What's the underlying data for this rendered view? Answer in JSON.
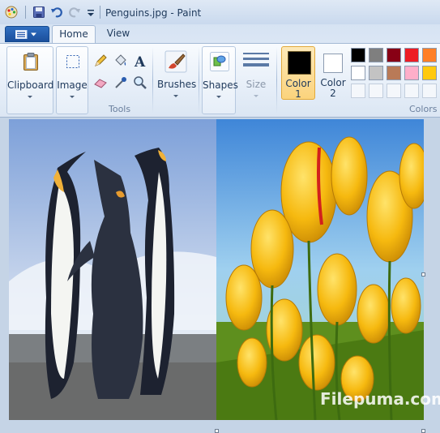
{
  "window": {
    "title": "Penguins.jpg - Paint"
  },
  "tabs": [
    {
      "label": "Home",
      "active": true
    },
    {
      "label": "View",
      "active": false
    }
  ],
  "ribbon": {
    "clipboard": "Clipboard",
    "image": "Image",
    "tools_group": "Tools",
    "brushes": "Brushes",
    "shapes": "Shapes",
    "size": "Size",
    "color1": "Color\n1",
    "color1_l1": "Color",
    "color1_l2": "1",
    "color2_l1": "Color",
    "color2_l2": "2",
    "colors_group": "Colors"
  },
  "palette": {
    "row1": [
      "#000000",
      "#7f7f7f",
      "#880015",
      "#ed1c24",
      "#ff7f27"
    ],
    "row2": [
      "#ffffff",
      "#c3c3c3",
      "#b97a57",
      "#ffaec9",
      "#ffc90e"
    ],
    "row3": [
      "#f4f7fb",
      "#f4f7fb",
      "#f4f7fb",
      "#f4f7fb",
      "#f4f7fb"
    ],
    "color1": "#000000",
    "color2": "#ffffff"
  },
  "watermark": "Filepuma.com"
}
